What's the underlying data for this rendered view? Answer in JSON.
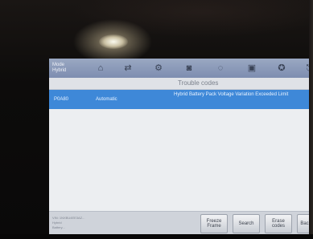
{
  "toolbar": {
    "mode_label": "Mode",
    "mode_sublabel": "Hybrid",
    "icons": [
      "home-icon",
      "swap-icon",
      "gear-icon",
      "car-icon",
      "info-icon",
      "print-icon",
      "help-icon",
      "exit-icon"
    ]
  },
  "page": {
    "title": "Trouble codes"
  },
  "codes": [
    {
      "code": "P0A80",
      "status": "Automatic",
      "description": "Hybrid Battery Pack Voltage Variation Exceeded Limit"
    }
  ],
  "footer": {
    "info_line_1": "VIN: 1NXBU4EE3AZ...",
    "info_line_2": "Hybrid",
    "info_line_3": "Battery..."
  },
  "buttons": {
    "freeze_frame": "Freeze Frame",
    "search": "Search",
    "erase_codes": "Erase codes",
    "back": "Back"
  },
  "colors": {
    "highlight_row": "#3e88d8",
    "toolbar": "#8b99ba"
  }
}
